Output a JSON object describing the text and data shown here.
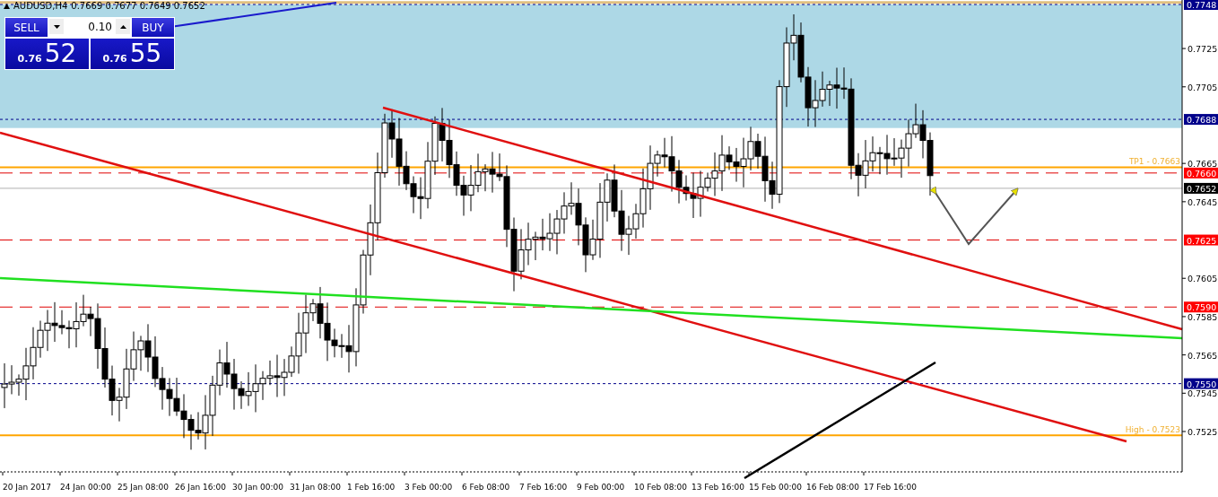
{
  "symbol_header": {
    "symbol": "AUDUSD,H4",
    "ohlc": "0.7669 0.7677 0.7649 0.7652"
  },
  "trade_panel": {
    "sell_label": "SELL",
    "buy_label": "BUY",
    "lot": "0.10",
    "sell_price": {
      "prefix": "0.76",
      "pips": "52"
    },
    "buy_price": {
      "prefix": "0.76",
      "pips": "55"
    }
  },
  "price_axis": {
    "ticks": [
      "0.7725",
      "0.7705",
      "0.7665",
      "0.7645",
      "0.7605",
      "0.7585",
      "0.7565",
      "0.7545",
      "0.7525"
    ]
  },
  "price_labels": [
    {
      "text": "0.7748",
      "color": "#00008b",
      "kind": "dotted"
    },
    {
      "text": "0.7688",
      "color": "#00008b",
      "kind": "dotted"
    },
    {
      "text": "0.7660",
      "color": "#ff0000",
      "kind": "dashed"
    },
    {
      "text": "0.7652",
      "color": "#000000",
      "kind": "last"
    },
    {
      "text": "0.7625",
      "color": "#ff0000",
      "kind": "dashed"
    },
    {
      "text": "0.7590",
      "color": "#ff0000",
      "kind": "dashed"
    },
    {
      "text": "0.7550",
      "color": "#00008b",
      "kind": "dotted"
    }
  ],
  "line_labels": [
    {
      "text": "TP1 - 0.7663"
    },
    {
      "text": "High - 0.7523"
    }
  ],
  "time_axis": {
    "labels": [
      "20 Jan 2017",
      "24 Jan 00:00",
      "25 Jan 08:00",
      "26 Jan 16:00",
      "30 Jan 00:00",
      "31 Jan 08:00",
      "1 Feb 16:00",
      "3 Feb 00:00",
      "6 Feb 08:00",
      "7 Feb 16:00",
      "9 Feb 00:00",
      "10 Feb 08:00",
      "13 Feb 16:00",
      "15 Feb 00:00",
      "16 Feb 08:00",
      "17 Feb 16:00"
    ]
  }
}
